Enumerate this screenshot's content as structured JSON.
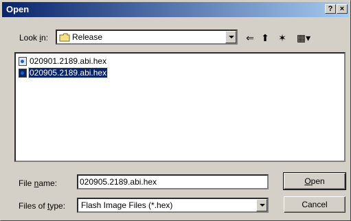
{
  "titlebar": {
    "title": "Open",
    "help": "?",
    "close": "×"
  },
  "lookin": {
    "label_pre": "Look ",
    "label_u": "i",
    "label_post": "n:",
    "value": "Release"
  },
  "toolbar": {
    "back": "⇐",
    "up": "⬆",
    "new_folder": "✶",
    "views": "▦▾"
  },
  "files": [
    {
      "name": "020901.2189.abi.hex",
      "selected": false
    },
    {
      "name": "020905.2189.abi.hex",
      "selected": true
    }
  ],
  "filename": {
    "label_pre": "File ",
    "label_u": "n",
    "label_post": "ame:",
    "value": "020905.2189.abi.hex"
  },
  "filetype": {
    "label_pre": "Files of ",
    "label_u": "t",
    "label_post": "ype:",
    "value": "Flash Image Files (*.hex)"
  },
  "buttons": {
    "open_u": "O",
    "open_rest": "pen",
    "cancel": "Cancel"
  },
  "colors": {
    "title_bar": "#0a246a",
    "face": "#d4d0c8",
    "selection": "#0a246a"
  }
}
